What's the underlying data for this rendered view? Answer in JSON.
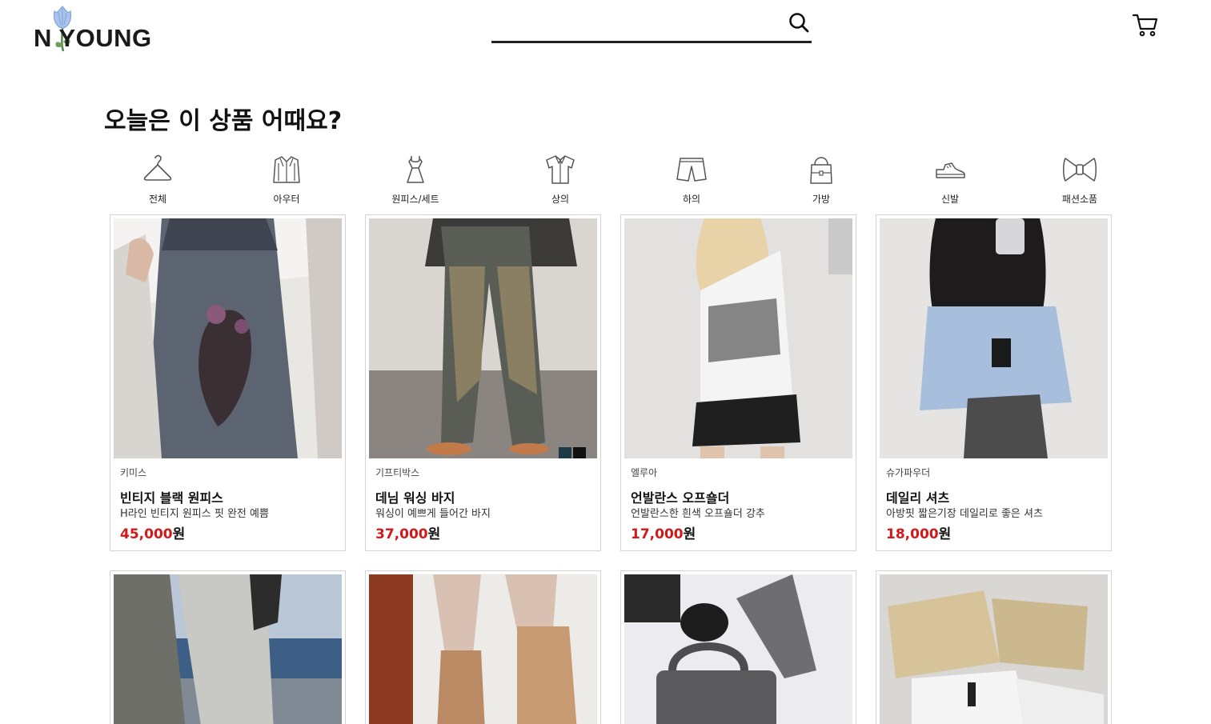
{
  "header": {
    "logo_text": "N YOUNG",
    "search": {
      "value": "",
      "placeholder": ""
    }
  },
  "section_title": "오늘은 이 상품 어때요?",
  "categories": [
    {
      "label": "전체",
      "icon": "hanger-icon"
    },
    {
      "label": "아우터",
      "icon": "jacket-icon"
    },
    {
      "label": "원피스/세트",
      "icon": "dress-icon"
    },
    {
      "label": "상의",
      "icon": "shirt-icon"
    },
    {
      "label": "하의",
      "icon": "shorts-icon"
    },
    {
      "label": "가방",
      "icon": "bag-icon"
    },
    {
      "label": "신발",
      "icon": "sneaker-icon"
    },
    {
      "label": "패션소품",
      "icon": "bow-icon"
    }
  ],
  "products": [
    {
      "brand": "키미스",
      "name": "빈티지 블랙 원피스",
      "desc": "H라인 빈티지 원피스 핏 완전 예쁨",
      "price": "45,000",
      "unit": "원"
    },
    {
      "brand": "기프티박스",
      "name": "데님 워싱 바지",
      "desc": "워싱이 예쁘게 들어간 바지",
      "price": "37,000",
      "unit": "원"
    },
    {
      "brand": "엘루아",
      "name": "언발란스 오프숄더",
      "desc": "언발란스한 흰색 오프숄더 강추",
      "price": "17,000",
      "unit": "원"
    },
    {
      "brand": "슈가파우더",
      "name": "데일리 셔츠",
      "desc": "아방핏 짧은기장 데일리로 좋은 셔츠",
      "price": "18,000",
      "unit": "원"
    }
  ],
  "colors": {
    "price": "#d41818",
    "border": "#d4d4d4",
    "accent_logo": "#7fa3d9"
  }
}
